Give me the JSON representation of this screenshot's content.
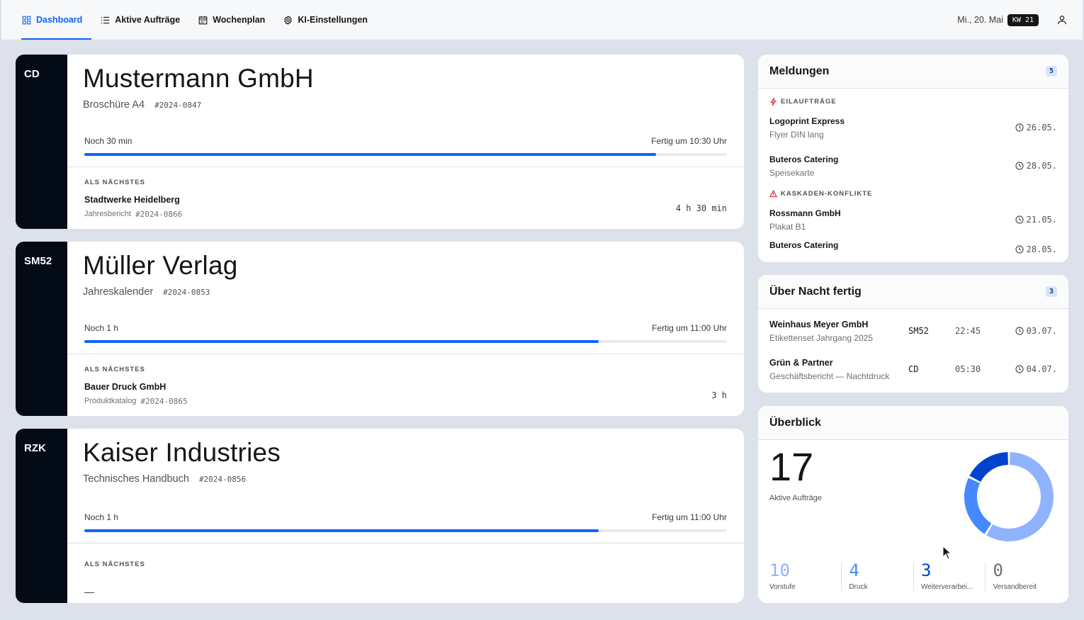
{
  "nav": {
    "tabs": [
      {
        "label": "Dashboard",
        "icon": "dashboard-icon",
        "active": true
      },
      {
        "label": "Aktive Aufträge",
        "icon": "list-icon"
      },
      {
        "label": "Wochenplan",
        "icon": "calendar-icon"
      },
      {
        "label": "KI-Einstellungen",
        "icon": "gear-icon"
      }
    ],
    "date": "Mi., 20. Mai",
    "week": "KW 21"
  },
  "machines": [
    {
      "code": "CD",
      "customer": "Mustermann GmbH",
      "product": "Broschüre A4",
      "job": "#2024-0847",
      "remaining": "Noch 30 min",
      "finish": "Fertig um 10:30 Uhr",
      "progress": 0.89,
      "next_label": "ALS NÄCHSTES",
      "next_customer": "Stadtwerke Heidelberg",
      "next_product": "Jahresbericht",
      "next_job": "#2024-0866",
      "next_duration": "4 h 30 min"
    },
    {
      "code": "SM52",
      "customer": "Müller Verlag",
      "product": "Jahreskalender",
      "job": "#2024-0853",
      "remaining": "Noch 1 h",
      "finish": "Fertig um 11:00 Uhr",
      "progress": 0.8,
      "next_label": "ALS NÄCHSTES",
      "next_customer": "Bauer Druck GmbH",
      "next_product": "Produktkatalog",
      "next_job": "#2024-0865",
      "next_duration": "3 h"
    },
    {
      "code": "RZK",
      "customer": "Kaiser Industries",
      "product": "Technisches Handbuch",
      "job": "#2024-0856",
      "remaining": "Noch 1 h",
      "finish": "Fertig um 11:00 Uhr",
      "progress": 0.8,
      "next_label": "ALS NÄCHSTES",
      "next_placeholder": "—"
    }
  ],
  "messages": {
    "title": "Meldungen",
    "count": "5",
    "rush_label": "EILAUFTRÄGE",
    "rush": [
      {
        "customer": "Logoprint Express",
        "product": "Flyer DIN lang",
        "date": "26.05."
      },
      {
        "customer": "Buteros Catering",
        "product": "Speisekarte",
        "date": "28.05."
      }
    ],
    "conflict_label": "KASKADEN-KONFLIKTE",
    "conflicts": [
      {
        "customer": "Rossmann GmbH",
        "product": "Plakat B1",
        "date": "21.05."
      },
      {
        "customer": "Buteros Catering",
        "product": "",
        "date": "28.05."
      }
    ]
  },
  "overnight": {
    "title": "Über Nacht fertig",
    "count": "3",
    "rows": [
      {
        "customer": "Weinhaus Meyer GmbH",
        "product": "Etikettenset Jahrgang 2025",
        "machine": "SM52",
        "time": "22:45",
        "date": "03.07."
      },
      {
        "customer": "Grün & Partner",
        "product": "Geschäftsbericht — Nachtdruck",
        "machine": "CD",
        "time": "05:30",
        "date": "04.07."
      }
    ]
  },
  "overview": {
    "title": "Überblick",
    "total": "17",
    "total_label": "Aktive Aufträge",
    "stats": [
      {
        "value": "10",
        "label": "Vorstufe",
        "color": "#8fb3ff"
      },
      {
        "value": "4",
        "label": "Druck",
        "color": "#4589ff"
      },
      {
        "value": "3",
        "label": "Weiterverarbei...",
        "color": "#0043ce"
      },
      {
        "value": "0",
        "label": "Versandbereit",
        "color": "#6f6f6f"
      }
    ]
  }
}
